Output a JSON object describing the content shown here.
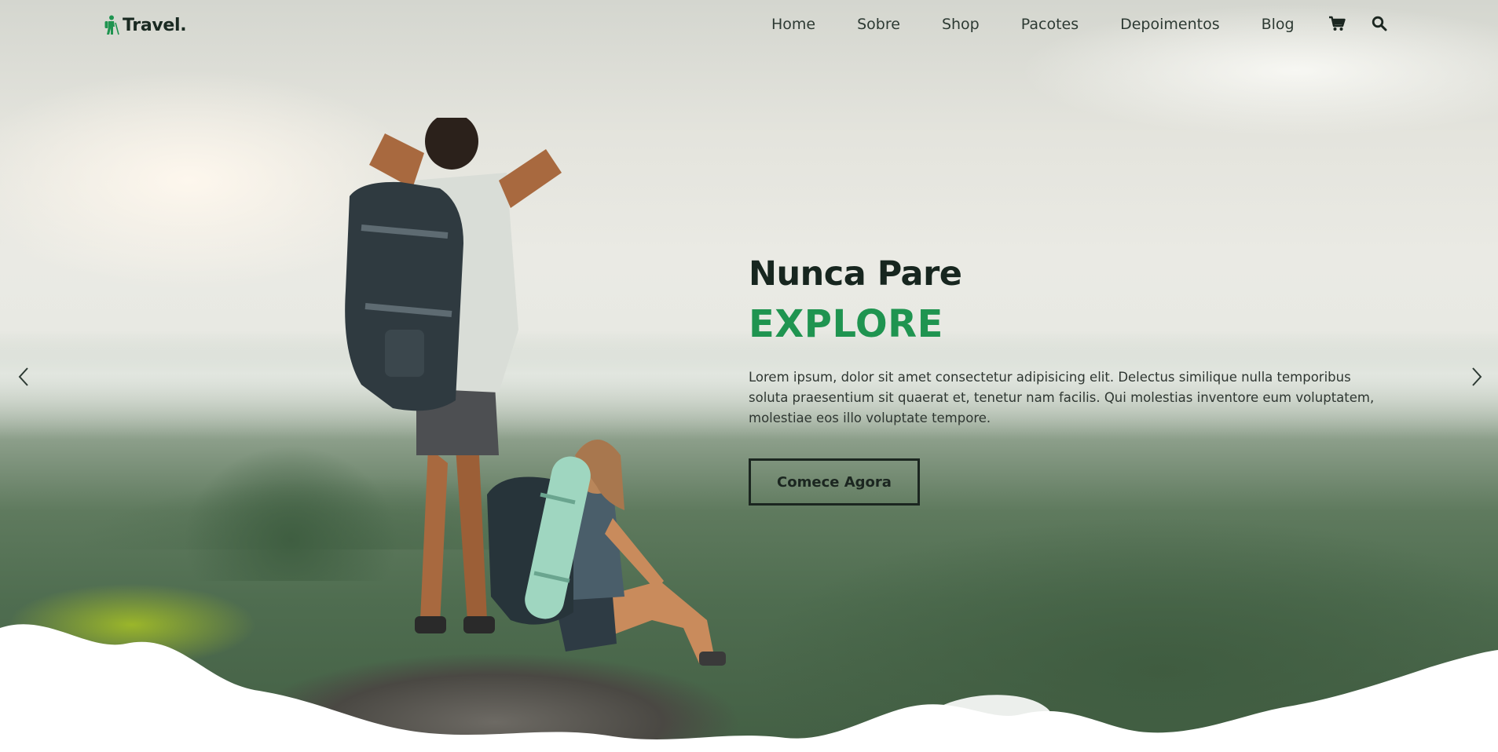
{
  "brand": {
    "name": "Travel.",
    "icon": "hiker-icon",
    "accent_color": "#1f9450"
  },
  "nav": {
    "links": [
      {
        "label": "Home"
      },
      {
        "label": "Sobre"
      },
      {
        "label": "Shop"
      },
      {
        "label": "Pacotes"
      },
      {
        "label": "Depoimentos"
      },
      {
        "label": "Blog"
      }
    ],
    "icons": [
      "cart-icon",
      "search-icon"
    ]
  },
  "hero": {
    "title": "Nunca Pare",
    "highlight": "EXPLORE",
    "description": "Lorem ipsum, dolor sit amet consectetur adipisicing elit. Delectus similique nulla temporibus soluta praesentium sit quaerat et, tenetur nam facilis. Qui molestias inventore eum voluptatem, molestiae eos illo voluptate tempore.",
    "cta_label": "Comece Agora"
  },
  "slider": {
    "prev_icon": "chevron-left-icon",
    "next_icon": "chevron-right-icon"
  }
}
